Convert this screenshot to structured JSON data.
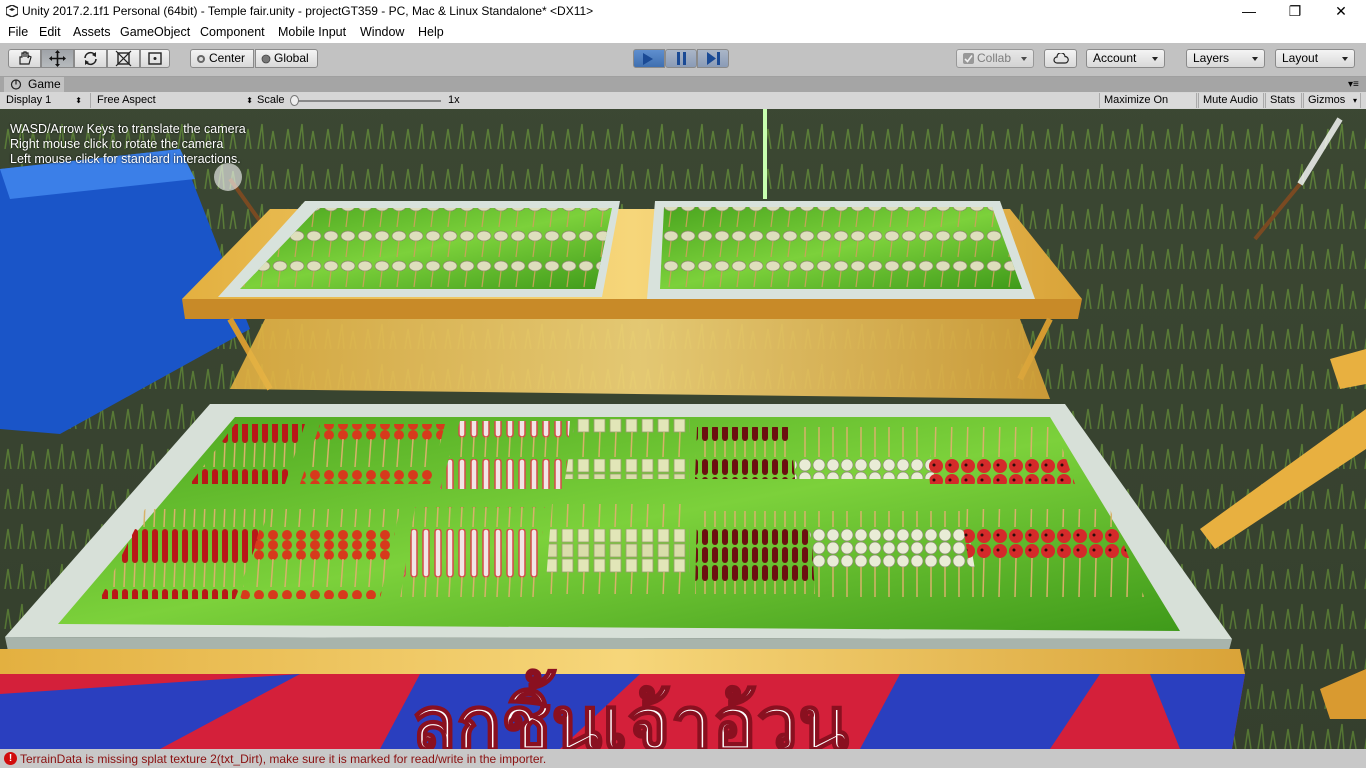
{
  "window": {
    "title": "Unity 2017.2.1f1 Personal (64bit) - Temple fair.unity - projectGT359 - PC, Mac & Linux Standalone* <DX11>",
    "minimize": "—",
    "maximize": "❐",
    "close": "✕"
  },
  "menu": [
    "File",
    "Edit",
    "Assets",
    "GameObject",
    "Component",
    "Mobile Input",
    "Window",
    "Help"
  ],
  "toolbar": {
    "pivot_mode": "Center",
    "pivot_rotation": "Global",
    "collab": "Collab",
    "account": "Account",
    "layers": "Layers",
    "layout": "Layout"
  },
  "game_tab": {
    "label": "Game",
    "display": "Display 1",
    "aspect": "Free Aspect",
    "scale_label": "Scale",
    "scale_value": "1x",
    "maximize_on_play": "Maximize On Play",
    "mute_audio": "Mute Audio",
    "stats": "Stats",
    "gizmos": "Gizmos"
  },
  "hud": {
    "line1": "WASD/Arrow Keys to translate the camera",
    "line2": "Right mouse click to rotate the camera",
    "line3": "Left mouse click for standard interactions."
  },
  "banner_text": "ลูกชิ้นเจ้าอ้วน",
  "status": {
    "message": "TerrainData is missing splat texture 2(txt_Dirt), make sure it is marked for read/write in the importer."
  },
  "colors": {
    "play_active": "#4a7fc4",
    "error": "#d10c0c"
  }
}
